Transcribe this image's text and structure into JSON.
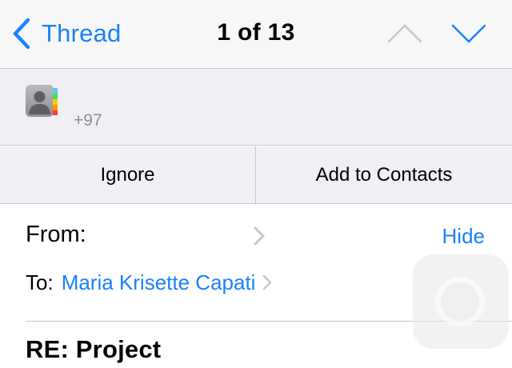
{
  "navbar": {
    "back_label": "Thread",
    "title": "1 of 13",
    "accent_color": "#1a82fb"
  },
  "sender": {
    "phone_partial": "+97",
    "icon": "contact-card-icon"
  },
  "actions": {
    "ignore_label": "Ignore",
    "add_label": "Add to Contacts"
  },
  "header": {
    "from_label": "From:",
    "hide_label": "Hide",
    "to_label": "To:",
    "to_name": "Maria Krisette Capati"
  },
  "message": {
    "subject": "RE: Project"
  }
}
